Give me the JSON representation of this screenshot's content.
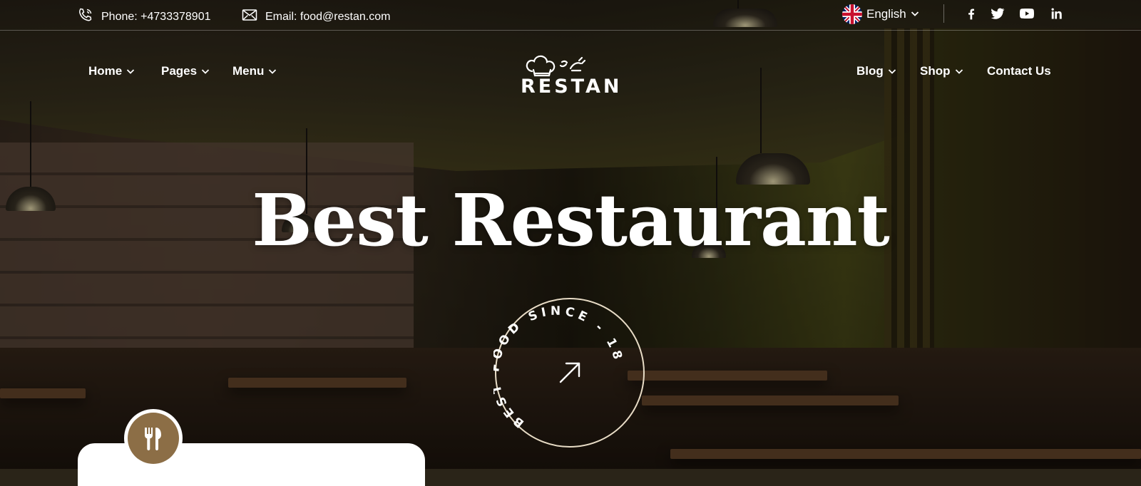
{
  "topbar": {
    "phone": "Phone: +4733378901",
    "email": "Email: food@restan.com",
    "language": "English",
    "social": [
      "facebook-icon",
      "twitter-icon",
      "youtube-icon",
      "linkedin-icon"
    ]
  },
  "nav": {
    "left": [
      {
        "label": "Home"
      },
      {
        "label": "Pages"
      },
      {
        "label": "Menu"
      }
    ],
    "right": [
      {
        "label": "Blog"
      },
      {
        "label": "Shop"
      },
      {
        "label": "Contact Us"
      }
    ]
  },
  "logo": {
    "text": "RESTAN"
  },
  "hero": {
    "title": "Best Restaurant",
    "badge_text": "BEST FOOD SINCE - 1865"
  },
  "colors": {
    "accent": "#8c6e46",
    "text": "#ffffff",
    "card": "#ffffff"
  }
}
